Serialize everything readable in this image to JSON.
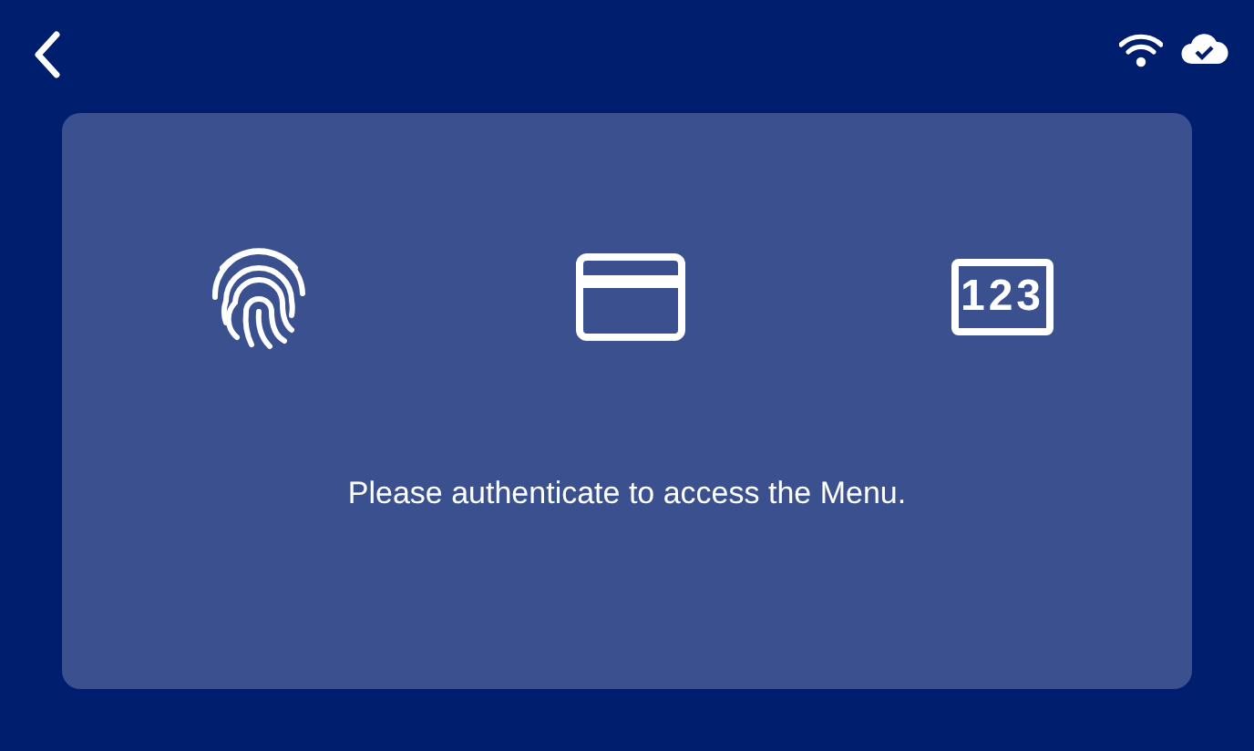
{
  "methods": [
    {
      "kind": "fingerprint"
    },
    {
      "kind": "card"
    },
    {
      "kind": "keypad",
      "label": "123"
    }
  ],
  "message": "Please authenticate to access the Menu."
}
